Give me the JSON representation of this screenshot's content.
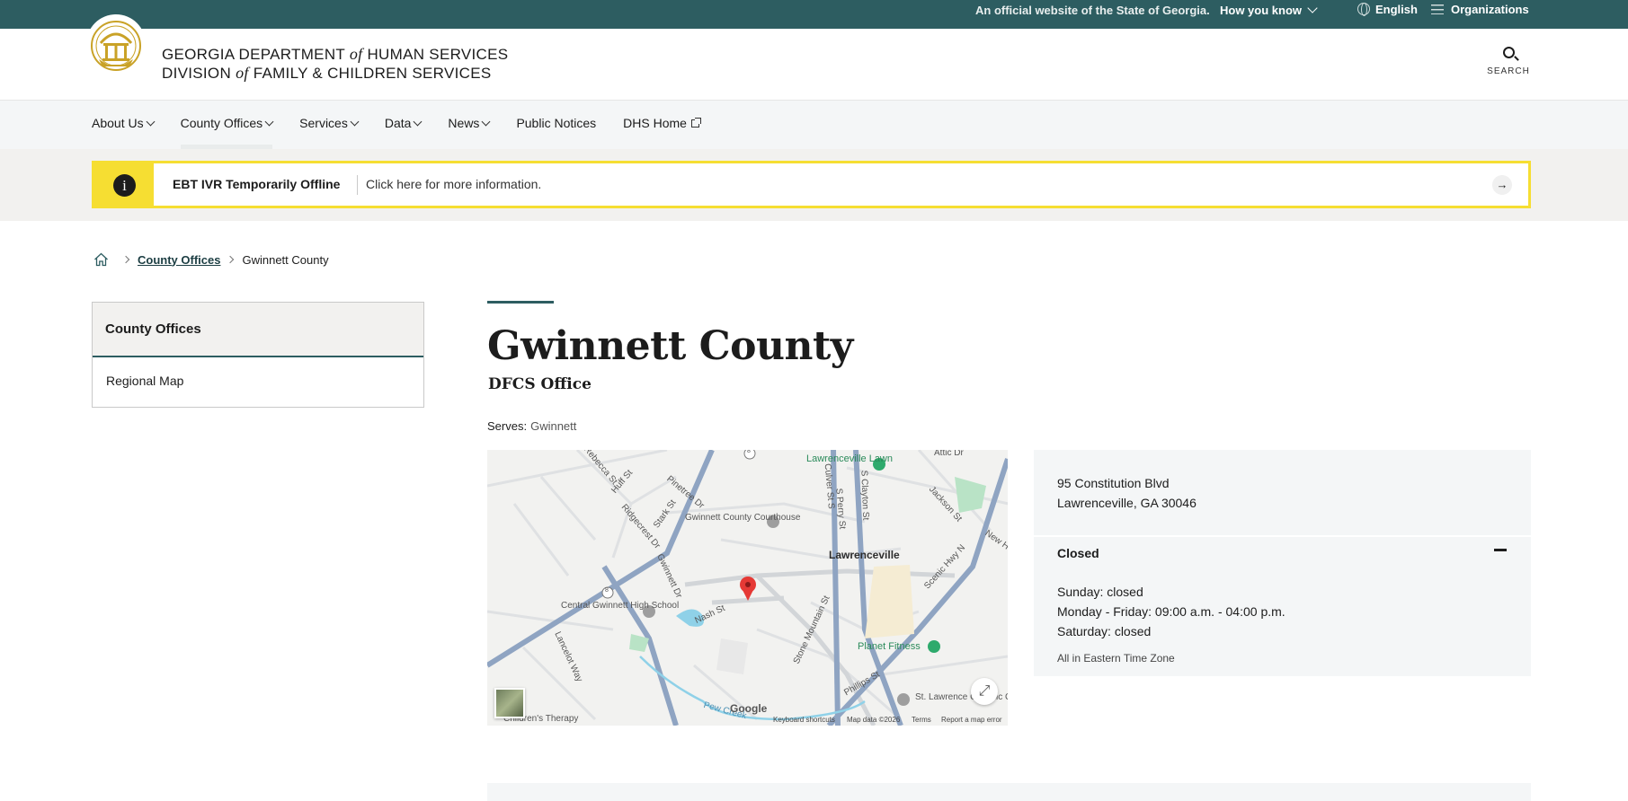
{
  "topbar": {
    "official": "An official website of the State of Georgia.",
    "how_you_know": "How you know",
    "language": "English",
    "organizations": "Organizations"
  },
  "header": {
    "agency_line1_a": "GEORGIA DEPARTMENT",
    "agency_line1_of": "of",
    "agency_line1_b": "HUMAN SERVICES",
    "agency_line2_a": "DIVISION",
    "agency_line2_of": "of",
    "agency_line2_b": "FAMILY & CHILDREN SERVICES",
    "search_label": "SEARCH"
  },
  "nav": {
    "items": [
      {
        "label": "About Us"
      },
      {
        "label": "County Offices"
      },
      {
        "label": "Services"
      },
      {
        "label": "Data"
      },
      {
        "label": "News"
      },
      {
        "label": "Public Notices"
      },
      {
        "label": "DHS Home"
      }
    ]
  },
  "alert": {
    "icon": "i",
    "title": "EBT IVR Temporarily Offline",
    "message": "Click here for more information.",
    "arrow": "→"
  },
  "breadcrumb": {
    "link": "County Offices",
    "current": "Gwinnett County"
  },
  "sidenav": {
    "heading": "County Offices",
    "item": "Regional Map"
  },
  "main": {
    "title": "Gwinnett County",
    "subtitle": "DFCS Office",
    "serves_label": "Serves:",
    "serves_value": "Gwinnett"
  },
  "map": {
    "labels": {
      "lawrenceville_lawn": "Lawrenceville Lawn",
      "courthouse": "Gwinnett County Courthouse",
      "lawrenceville": "Lawrenceville",
      "central_hs": "Central Gwinnett High School",
      "planet_fitness": "Planet Fitness",
      "st_lawrence": "St. Lawrence Catholic Church",
      "childrens": "Children's Therapy",
      "rebecca": "Rebecca St",
      "huff": "Huff St",
      "pinetree": "Pinetree Dr",
      "stark": "Stark St",
      "ridgecrest": "Ridgecrest Dr",
      "gwinnett_dr": "Gwinnett Dr",
      "nash": "Nash St",
      "lancelot": "Lancelot Way",
      "stone_mountain": "Stone Mountain St",
      "culver": "Culver St S",
      "perry": "S Perry St",
      "clayton": "S Clayton St",
      "jackson": "Jackson St",
      "scenic": "Scenic Hwy N",
      "phillips": "Phillips St",
      "pew_creek": "Pew Creek",
      "attic": "Attic Dr",
      "new": "New H",
      "route8a": "8",
      "route8b": "8"
    },
    "google": "Google",
    "footer": {
      "keyboard": "Keyboard shortcuts",
      "mapdata": "Map data ©2026",
      "terms": "Terms",
      "report": "Report a map error"
    }
  },
  "office": {
    "address_line1": "95 Constitution Blvd",
    "address_line2": "Lawrenceville, GA 30046",
    "status": "Closed",
    "hours": [
      "Sunday: closed",
      "Monday - Friday: 09:00 a.m. - 04:00 p.m.",
      "Saturday: closed"
    ],
    "timezone": "All in Eastern Time Zone"
  },
  "colors": {
    "brand_teal": "#2d5d61",
    "alert_yellow": "#f6de32",
    "map_pin_red": "#e53935"
  }
}
